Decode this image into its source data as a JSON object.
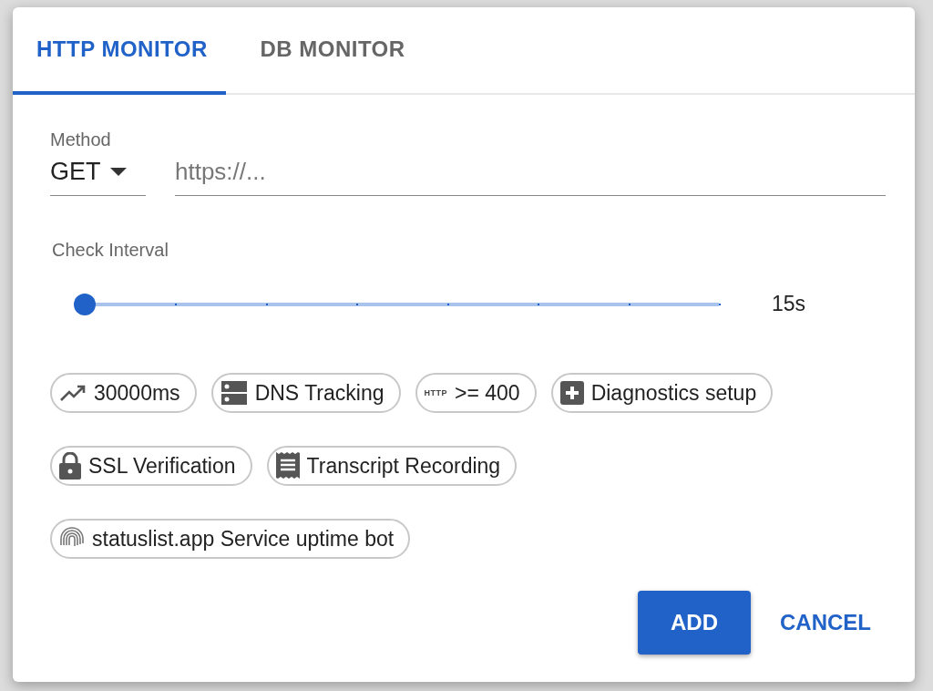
{
  "tabs": [
    {
      "label": "HTTP MONITOR",
      "selected": true
    },
    {
      "label": "DB MONITOR",
      "selected": false
    }
  ],
  "method": {
    "label": "Method",
    "value": "GET"
  },
  "url": {
    "placeholder": "https://..."
  },
  "interval": {
    "label": "Check Interval",
    "level": 0,
    "reading": "15s"
  },
  "chips": [
    {
      "kind": "trend",
      "label": "30000ms"
    },
    {
      "kind": "dns",
      "label": "DNS Tracking"
    },
    {
      "kind": "text-icon",
      "icon_text": "HTTP",
      "label": ">= 400"
    },
    {
      "kind": "plus",
      "label": "Diagnostics setup"
    },
    {
      "kind": "lock",
      "label": "SSL Verification"
    },
    {
      "kind": "receipt",
      "label": "Transcript Recording"
    },
    {
      "kind": "fingerprint",
      "label": "statuslist.app Service uptime bot"
    }
  ],
  "actions": {
    "primary": "ADD",
    "secondary": "CANCEL"
  }
}
